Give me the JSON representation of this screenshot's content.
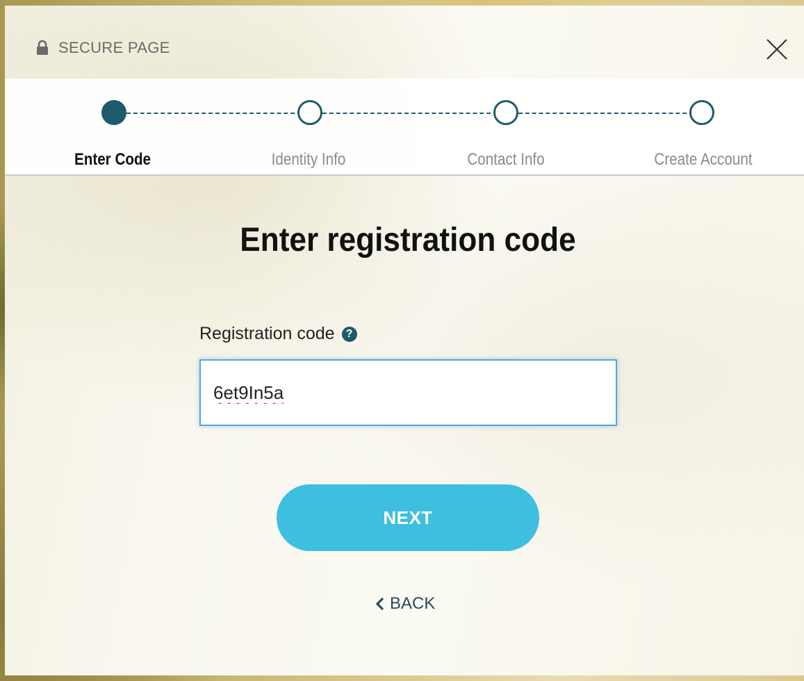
{
  "header": {
    "secure_label": "SECURE PAGE",
    "lock_icon": "lock-icon",
    "close_icon": "close-icon"
  },
  "stepper": {
    "steps": [
      {
        "label": "Enter Code",
        "state": "active"
      },
      {
        "label": "Identity Info",
        "state": "inactive"
      },
      {
        "label": "Contact Info",
        "state": "inactive"
      },
      {
        "label": "Create Account",
        "state": "inactive"
      }
    ],
    "active_color": "#1d5a6a"
  },
  "main": {
    "title": "Enter registration code",
    "field_label": "Registration code",
    "help_icon": "question-circle-icon",
    "help_glyph": "?",
    "input_value": "6et9In5a",
    "next_label": "NEXT",
    "back_label": "BACK",
    "back_icon": "chevron-left-icon"
  },
  "colors": {
    "button": "#3fbfdf",
    "accent": "#1d5a6a"
  }
}
